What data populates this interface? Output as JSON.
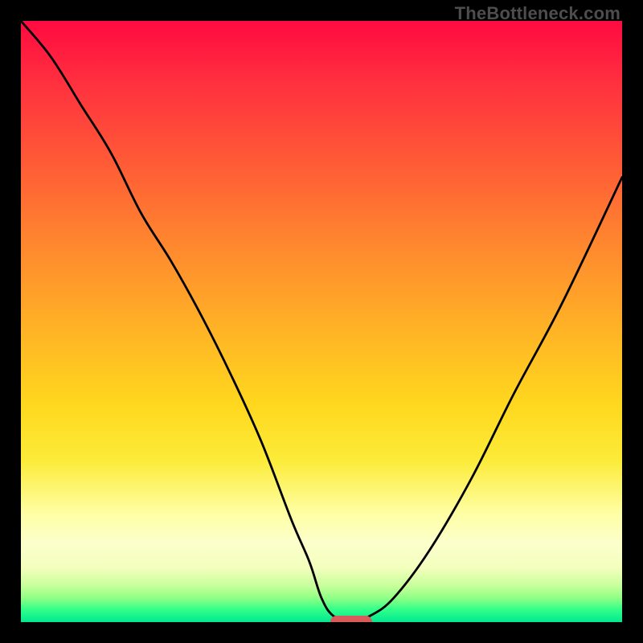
{
  "watermark": "TheBottleneck.com",
  "colors": {
    "frame": "#000000",
    "curve": "#000000",
    "marker": "#d85a5a"
  },
  "chart_data": {
    "type": "line",
    "title": "",
    "xlabel": "",
    "ylabel": "",
    "xlim": [
      0,
      100
    ],
    "ylim": [
      0,
      100
    ],
    "grid": false,
    "legend": false,
    "series": [
      {
        "name": "bottleneck-curve",
        "x": [
          0,
          5,
          10,
          15,
          20,
          25,
          30,
          35,
          40,
          45,
          48,
          50,
          52,
          55,
          58,
          62,
          68,
          75,
          82,
          90,
          100
        ],
        "y": [
          100,
          94,
          86,
          78,
          68,
          60,
          51,
          41,
          30,
          17,
          10,
          4,
          1,
          0,
          1,
          4,
          12,
          24,
          38,
          53,
          74
        ]
      }
    ],
    "marker": {
      "x": 55,
      "y": 0
    },
    "background_gradient": {
      "stops": [
        {
          "pos": 0.0,
          "color": "#ff0a40"
        },
        {
          "pos": 0.1,
          "color": "#ff2f3f"
        },
        {
          "pos": 0.24,
          "color": "#ff5c36"
        },
        {
          "pos": 0.38,
          "color": "#ff8a2e"
        },
        {
          "pos": 0.52,
          "color": "#ffb525"
        },
        {
          "pos": 0.64,
          "color": "#ffd81e"
        },
        {
          "pos": 0.73,
          "color": "#fceb38"
        },
        {
          "pos": 0.82,
          "color": "#feffa5"
        },
        {
          "pos": 0.87,
          "color": "#fcffcc"
        },
        {
          "pos": 0.91,
          "color": "#f3ffbd"
        },
        {
          "pos": 0.94,
          "color": "#c6ff9a"
        },
        {
          "pos": 0.96,
          "color": "#8fff85"
        },
        {
          "pos": 0.98,
          "color": "#2fff8a"
        },
        {
          "pos": 1.0,
          "color": "#00e890"
        }
      ]
    }
  }
}
